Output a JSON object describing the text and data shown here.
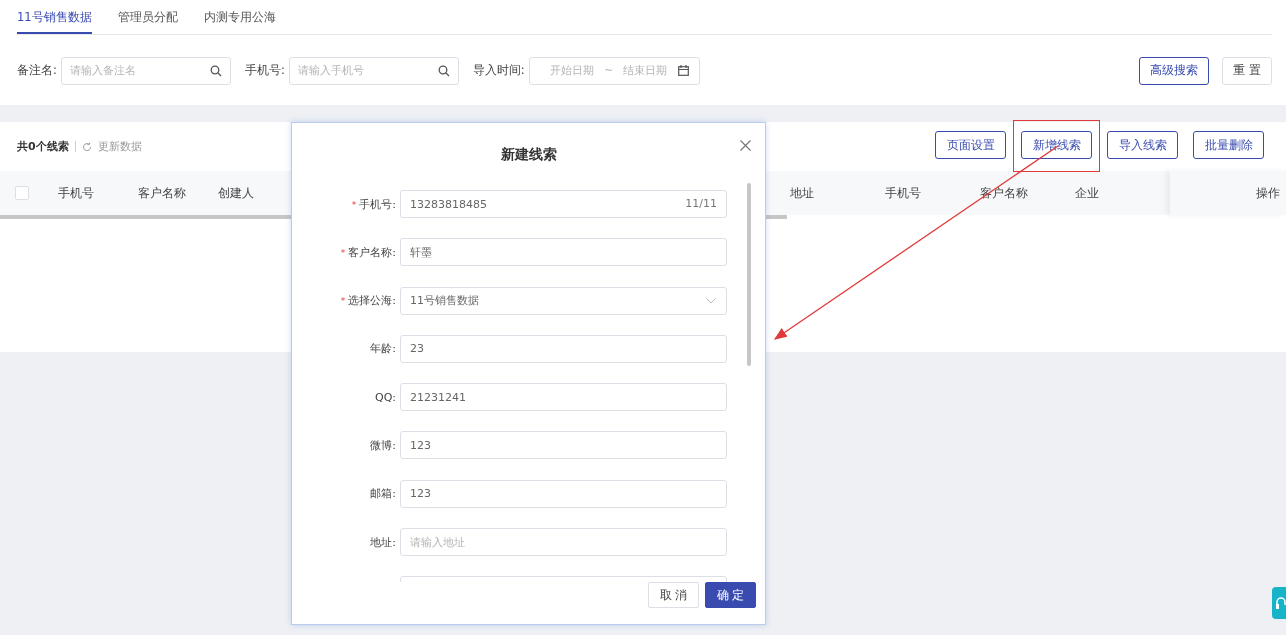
{
  "tabs": [
    {
      "label": "11号销售数据",
      "selected": true
    },
    {
      "label": "管理员分配",
      "selected": false
    },
    {
      "label": "内测专用公海",
      "selected": false
    }
  ],
  "filters": [
    {
      "kind": "search",
      "label": "备注名:",
      "placeholder": "请输入备注名"
    },
    {
      "kind": "search",
      "label": "手机号:",
      "placeholder": "请输入手机号"
    },
    {
      "kind": "daterange",
      "label": "导入时间:",
      "start_placeholder": "开始日期",
      "separator": "~",
      "end_placeholder": "结束日期"
    }
  ],
  "filter_buttons": [
    {
      "label": "高级搜索",
      "kind": "primary"
    },
    {
      "label": "重 置",
      "kind": "plain"
    }
  ],
  "summary": {
    "count": "共0个线索",
    "refresh": "更新数据"
  },
  "toolbar_buttons": [
    {
      "label": "页面设置",
      "highlighted": false
    },
    {
      "label": "新增线索",
      "highlighted": true
    },
    {
      "label": "导入线索",
      "highlighted": false
    },
    {
      "label": "批量删除",
      "highlighted": false
    }
  ],
  "table": {
    "select_all": {
      "checked": false
    },
    "columns_left": [
      "手机号",
      "客户名称",
      "创建人"
    ],
    "columns_right": [
      "地址",
      "手机号",
      "客户名称",
      "企业"
    ],
    "action_column": "操作"
  },
  "dialog": {
    "title": "新建线索",
    "required_mark": "*",
    "fields": [
      {
        "kind": "text",
        "label": "手机号:",
        "required": true,
        "value": "13283818485",
        "counter": "11/11"
      },
      {
        "kind": "text",
        "label": "客户名称:",
        "required": true,
        "value": "轩墨"
      },
      {
        "kind": "select",
        "label": "选择公海:",
        "required": true,
        "value": "11号销售数据"
      },
      {
        "kind": "text",
        "label": "年龄:",
        "required": false,
        "value": "23"
      },
      {
        "kind": "text",
        "label": "QQ:",
        "required": false,
        "value": "21231241"
      },
      {
        "kind": "text",
        "label": "微博:",
        "required": false,
        "value": "123"
      },
      {
        "kind": "text",
        "label": "邮箱:",
        "required": false,
        "value": "123"
      },
      {
        "kind": "text",
        "label": "地址:",
        "required": false,
        "placeholder": "请输入地址"
      },
      {
        "kind": "text"
      }
    ],
    "buttons": [
      {
        "label": "取 消",
        "kind": "plain"
      },
      {
        "label": "确 定",
        "kind": "primary"
      }
    ]
  }
}
